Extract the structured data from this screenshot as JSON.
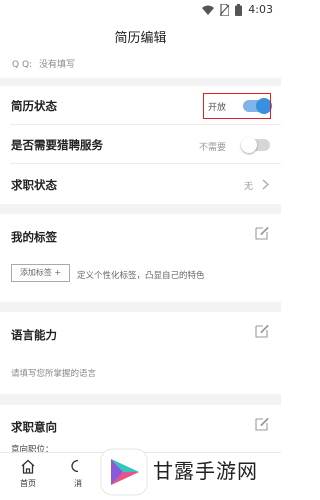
{
  "status_bar": {
    "time": "4:03"
  },
  "header": {
    "title": "简历编辑"
  },
  "contact": {
    "qq_label": "Q Q:",
    "qq_value": "没有填写"
  },
  "settings": [
    {
      "label": "简历状态",
      "value": "开放",
      "toggle_on": true
    },
    {
      "label": "是否需要猎聘服务",
      "value": "不需要",
      "toggle_on": false
    },
    {
      "label": "求职状态",
      "value": "无"
    }
  ],
  "tags_section": {
    "title": "我的标签",
    "add_button": "添加标签 +",
    "hint": "定义个性化标签，凸显自己的特色"
  },
  "language_section": {
    "title": "语言能力",
    "hint": "请填写您所掌握的语言"
  },
  "intent_section": {
    "title": "求职意向",
    "partial_label": "意向职位："
  },
  "bottom_nav": {
    "home_label": "首页",
    "second_label": "消"
  },
  "watermark": {
    "text": "甘露手游网"
  },
  "colors": {
    "accent": "#3a8fe0",
    "highlight": "#e02020",
    "gap": "#f3f3f3"
  }
}
